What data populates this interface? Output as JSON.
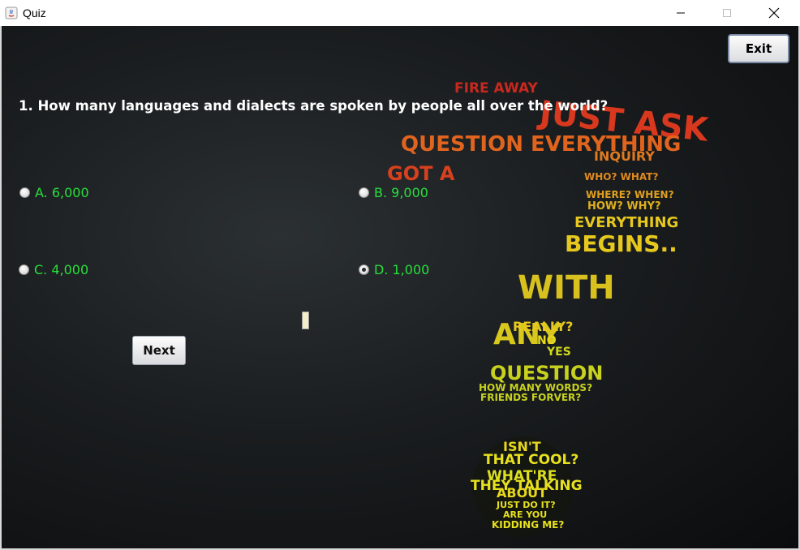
{
  "window": {
    "title": "Quiz",
    "controls": {
      "minimize": "—",
      "maximize": "☐",
      "close": "✕"
    }
  },
  "toolbar": {
    "exit_label": "Exit"
  },
  "quiz": {
    "question": "1. How many languages and dialects are spoken by people all over the world?",
    "options": [
      {
        "label": "A. 6,000",
        "selected": false
      },
      {
        "label": "B. 9,000",
        "selected": false
      },
      {
        "label": "C. 4,000",
        "selected": false
      },
      {
        "label": "D. 1,000",
        "selected": true
      }
    ],
    "next_label": "Next"
  },
  "background_art": {
    "words": [
      "FIRE AWAY",
      "JUST ASK",
      "QUESTION EVERYTHING",
      "INQUIRY",
      "GOT A",
      "WHO? WHAT?",
      "WHERE? WHEN?",
      "HOW? WHY?",
      "EVERYTHING",
      "BEGINS..",
      "WITH",
      "ANY",
      "REALLY?",
      "NO",
      "YES",
      "QUESTION",
      "HOW MANY WORDS?",
      "FRIENDS FORVER?",
      "ISN'T",
      "THAT COOL?",
      "WHAT'RE",
      "THEY TALKING",
      "ABOUT",
      "JUST DO IT?",
      "ARE YOU",
      "KIDDING ME?"
    ],
    "colors": {
      "red": "#c8281e",
      "orange": "#e0641e",
      "yellow": "#e6c81e",
      "green": "#b4c828"
    }
  },
  "colors": {
    "option_text": "#28e03c",
    "question_text": "#ffffff"
  }
}
